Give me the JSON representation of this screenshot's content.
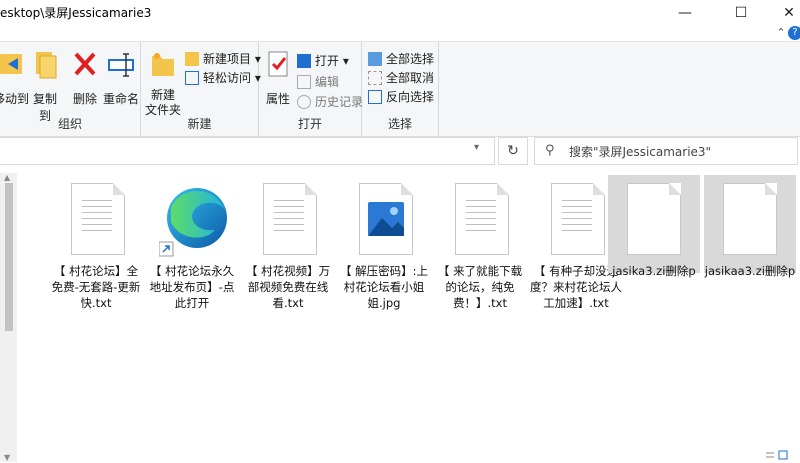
{
  "window": {
    "title": "esktop\\录屏Jessicamarie3",
    "minimize": "—",
    "maximize": "☐",
    "close": "✕"
  },
  "ribbon": {
    "groups": [
      {
        "label": "组织",
        "buttons": [
          "移动到",
          "复制到",
          "删除",
          "重命名"
        ]
      },
      {
        "label": "新建",
        "big": "新建\n文件夹",
        "items": [
          "新建项目 ▾",
          "轻松访问 ▾"
        ]
      },
      {
        "label": "打开",
        "big": "属性",
        "items": [
          "打开 ▾",
          "编辑",
          "历史记录"
        ]
      },
      {
        "label": "选择",
        "items": [
          "全部选择",
          "全部取消",
          "反向选择"
        ]
      }
    ]
  },
  "address": {
    "search_placeholder": "搜索\"录屏Jessicamarie3\""
  },
  "files": [
    {
      "name": "【 村花论坛】全免费-无套路-更新快.txt",
      "type": "txt"
    },
    {
      "name": "【 村花论坛永久地址发布页】-点此打开",
      "type": "edge-shortcut"
    },
    {
      "name": "【 村花视频】万部视频免费在线看.txt",
      "type": "txt"
    },
    {
      "name": "【 解压密码】:上村花论坛看小姐姐.jpg",
      "type": "jpg"
    },
    {
      "name": "【 来了就能下载的论坛，纯免费！】.txt",
      "type": "txt"
    },
    {
      "name": "【 有种子却没速度？来村花论坛人工加速】.txt",
      "type": "txt"
    },
    {
      "name": "jasika3.zi删除p",
      "type": "blank",
      "selected": true
    },
    {
      "name": "jasikaa3.zi删除p",
      "type": "blank",
      "selected": true
    }
  ],
  "colors": {
    "accent": "#1e6fd1",
    "selection": "#d9d9d9",
    "ribbon_bg": "#f5f6f7",
    "delete_red": "#e02020"
  }
}
